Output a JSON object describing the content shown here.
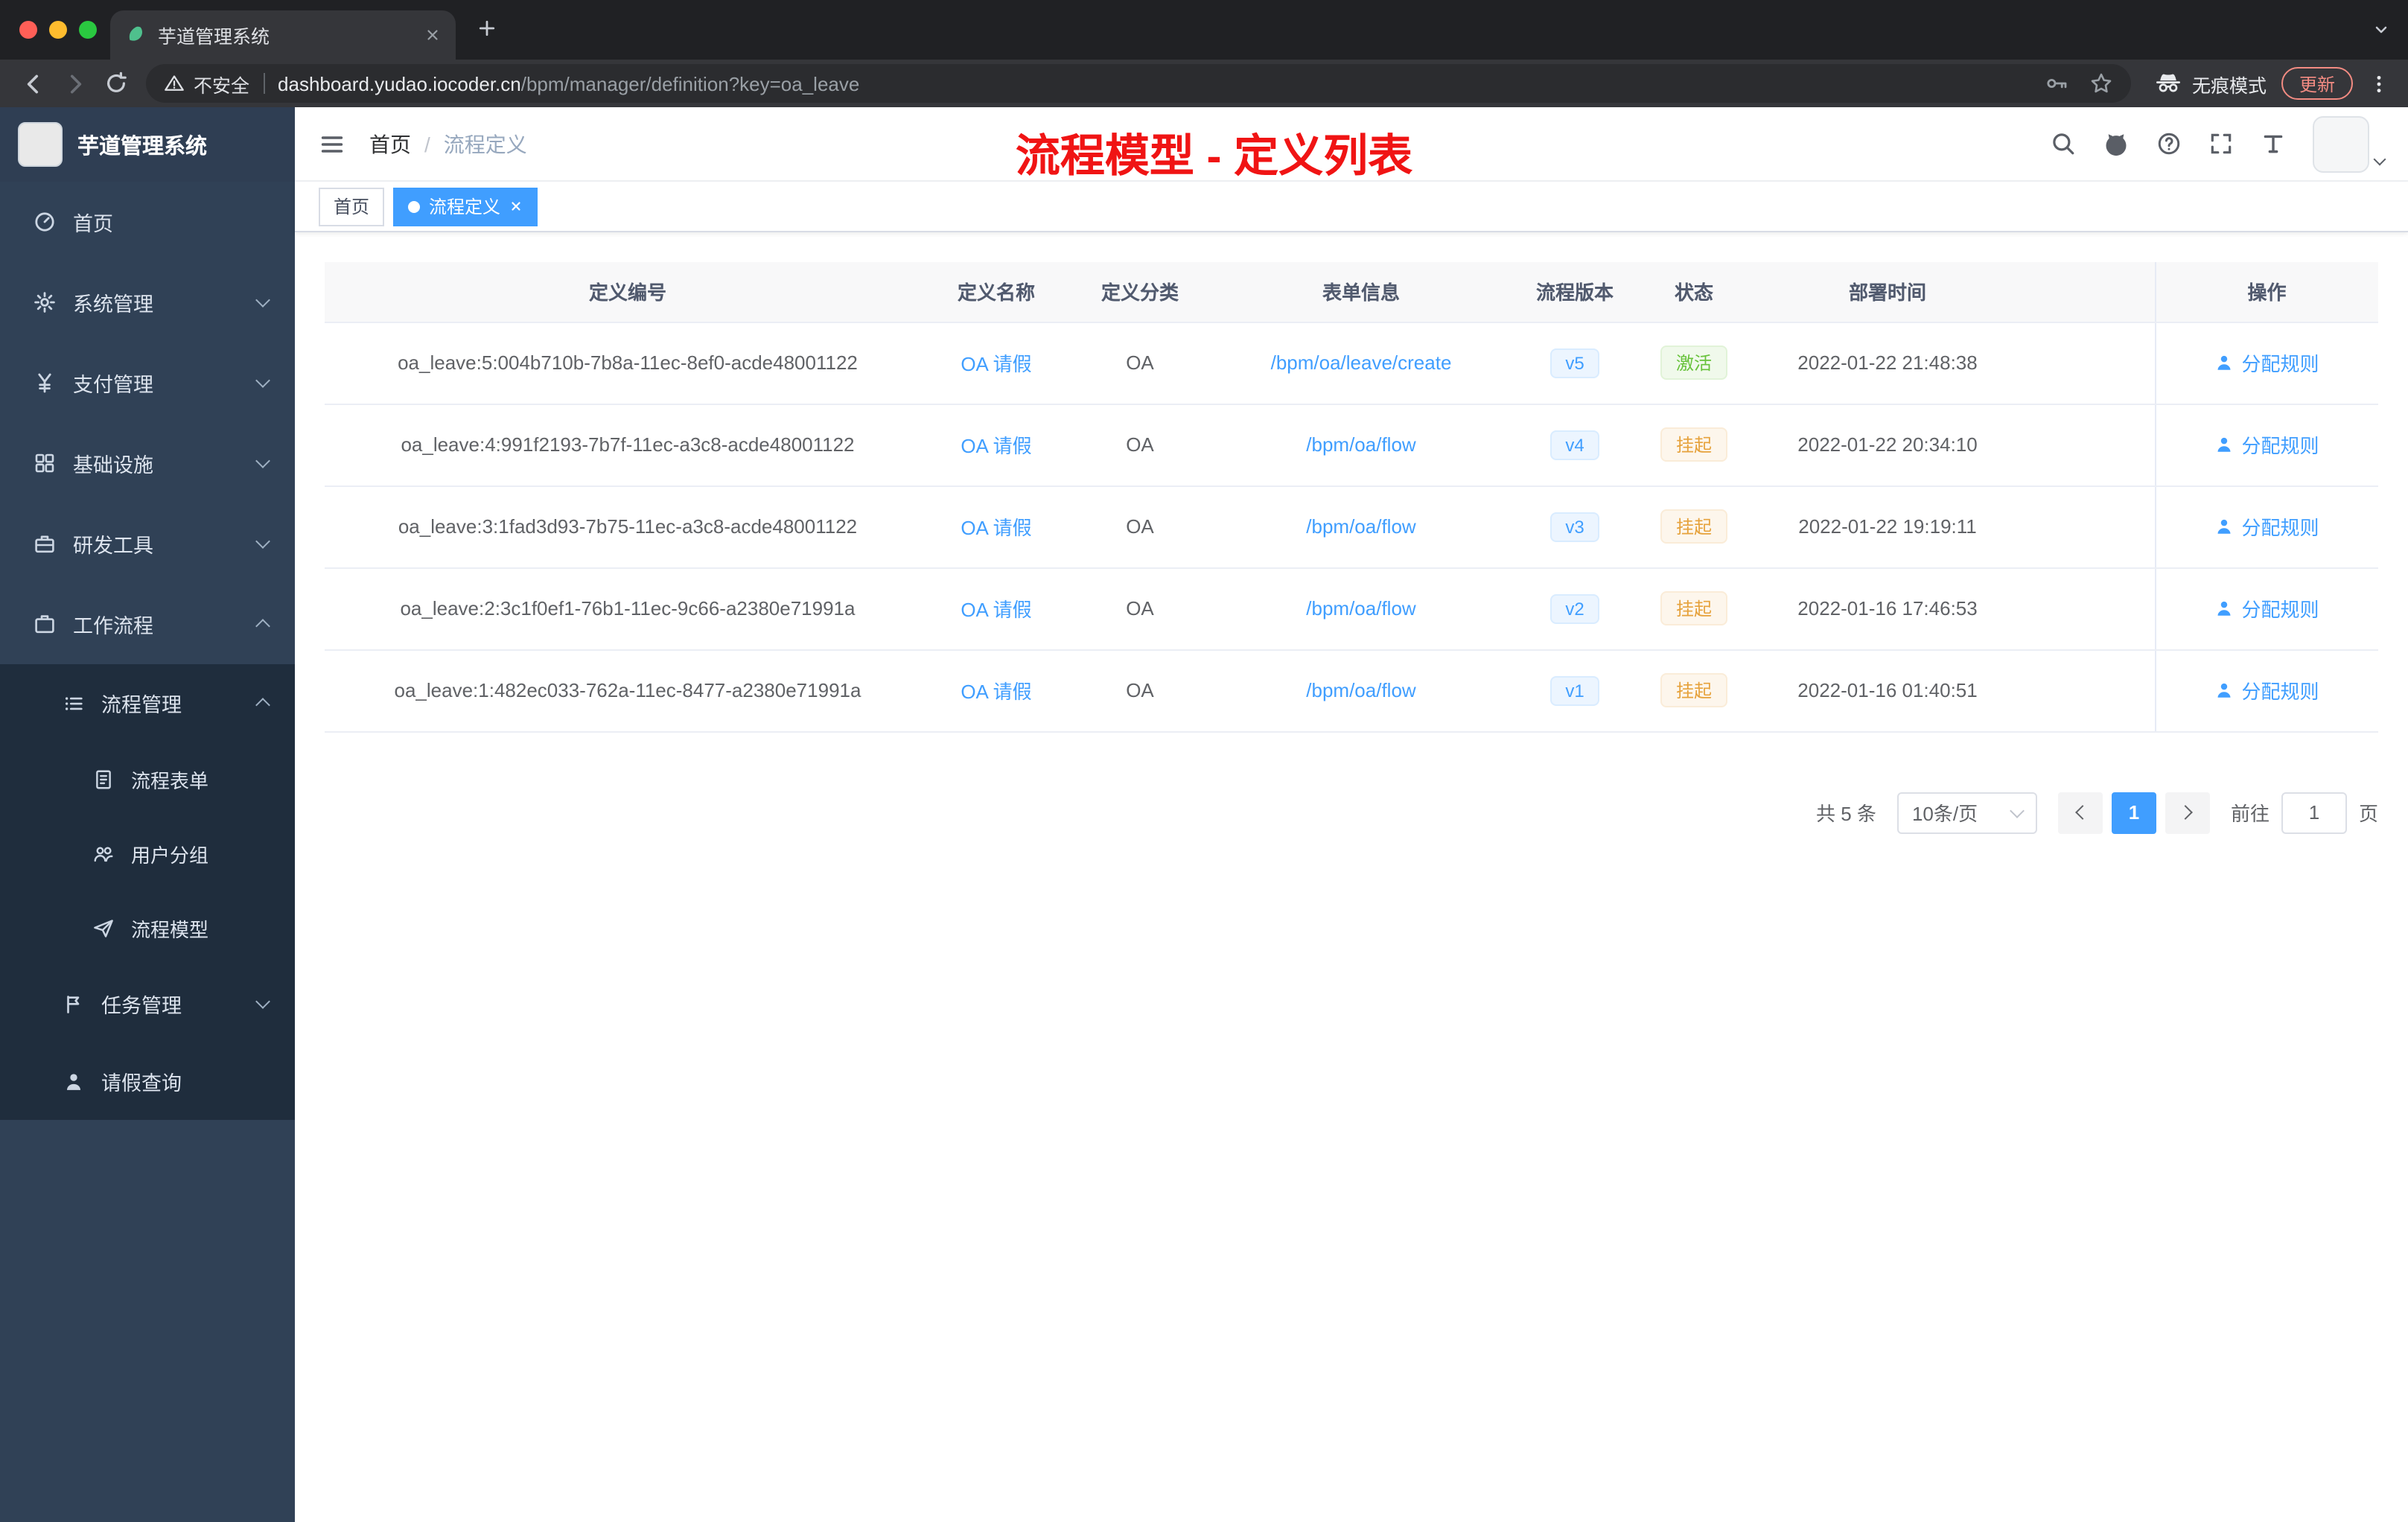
{
  "browser": {
    "tab_title": "芋道管理系统",
    "security_label": "不安全",
    "url_domain": "dashboard.yudao.iocoder.cn",
    "url_path": "/bpm/manager/definition?key=oa_leave",
    "incognito_label": "无痕模式",
    "update_label": "更新"
  },
  "sidebar": {
    "logo_title": "芋道管理系统",
    "items": [
      {
        "label": "首页"
      },
      {
        "label": "系统管理"
      },
      {
        "label": "支付管理"
      },
      {
        "label": "基础设施"
      },
      {
        "label": "研发工具"
      },
      {
        "label": "工作流程"
      },
      {
        "label": "流程管理"
      },
      {
        "label": "流程表单"
      },
      {
        "label": "用户分组"
      },
      {
        "label": "流程模型"
      },
      {
        "label": "任务管理"
      },
      {
        "label": "请假查询"
      }
    ]
  },
  "header": {
    "breadcrumb_home": "首页",
    "breadcrumb_current": "流程定义",
    "annotation": "流程模型 - 定义列表"
  },
  "tags": [
    {
      "label": "首页"
    },
    {
      "label": "流程定义"
    }
  ],
  "table": {
    "columns": [
      "定义编号",
      "定义名称",
      "定义分类",
      "表单信息",
      "流程版本",
      "状态",
      "部署时间",
      "操作"
    ],
    "rows": [
      {
        "id": "oa_leave:5:004b710b-7b8a-11ec-8ef0-acde48001122",
        "name": "OA 请假",
        "category": "OA",
        "form": "/bpm/oa/leave/create",
        "version": "v5",
        "status": "激活",
        "status_type": "success",
        "deployed": "2022-01-22 21:48:38",
        "action": "分配规则"
      },
      {
        "id": "oa_leave:4:991f2193-7b7f-11ec-a3c8-acde48001122",
        "name": "OA 请假",
        "category": "OA",
        "form": "/bpm/oa/flow",
        "version": "v4",
        "status": "挂起",
        "status_type": "warning",
        "deployed": "2022-01-22 20:34:10",
        "action": "分配规则"
      },
      {
        "id": "oa_leave:3:1fad3d93-7b75-11ec-a3c8-acde48001122",
        "name": "OA 请假",
        "category": "OA",
        "form": "/bpm/oa/flow",
        "version": "v3",
        "status": "挂起",
        "status_type": "warning",
        "deployed": "2022-01-22 19:19:11",
        "action": "分配规则"
      },
      {
        "id": "oa_leave:2:3c1f0ef1-76b1-11ec-9c66-a2380e71991a",
        "name": "OA 请假",
        "category": "OA",
        "form": "/bpm/oa/flow",
        "version": "v2",
        "status": "挂起",
        "status_type": "warning",
        "deployed": "2022-01-16 17:46:53",
        "action": "分配规则"
      },
      {
        "id": "oa_leave:1:482ec033-762a-11ec-8477-a2380e71991a",
        "name": "OA 请假",
        "category": "OA",
        "form": "/bpm/oa/flow",
        "version": "v1",
        "status": "挂起",
        "status_type": "warning",
        "deployed": "2022-01-16 01:40:51",
        "action": "分配规则"
      }
    ]
  },
  "pagination": {
    "total": "共 5 条",
    "page_size": "10条/页",
    "current_page": "1",
    "goto_label": "前往",
    "goto_value": "1",
    "page_unit": "页"
  },
  "colors": {
    "accent": "#409eff",
    "annotation_red": "#f01414",
    "success": "#67c23a",
    "warning": "#e6a23c",
    "sidebar_bg": "#304156",
    "submenu_bg": "#1f2d3d"
  }
}
